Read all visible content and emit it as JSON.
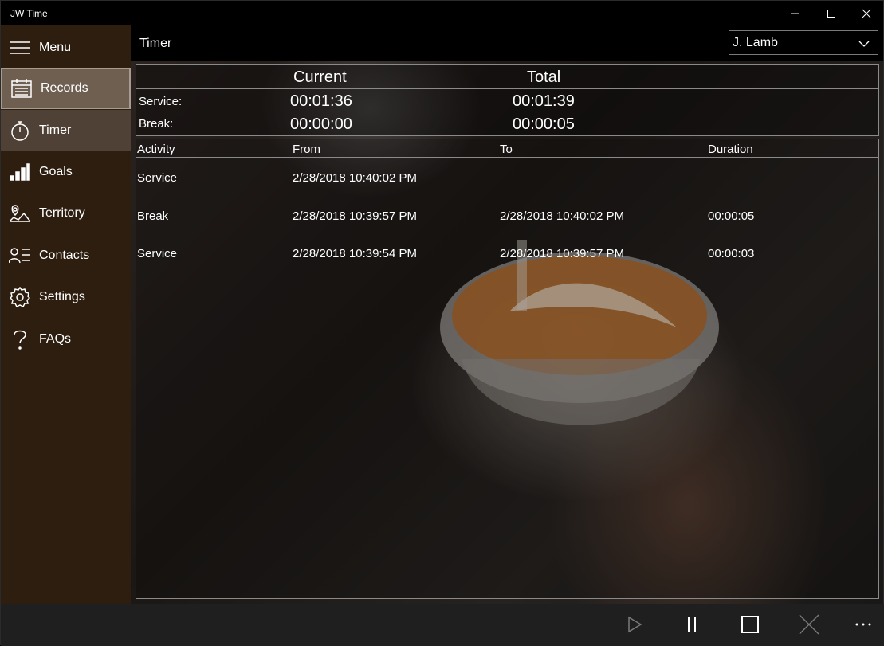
{
  "window": {
    "title": "JW Time"
  },
  "sidebar": {
    "items": [
      {
        "label": "Menu",
        "icon": "hamburger-icon"
      },
      {
        "label": "Records",
        "icon": "calendar-icon"
      },
      {
        "label": "Timer",
        "icon": "stopwatch-icon"
      },
      {
        "label": "Goals",
        "icon": "bar-chart-icon"
      },
      {
        "label": "Territory",
        "icon": "map-pin-icon"
      },
      {
        "label": "Contacts",
        "icon": "contacts-icon"
      },
      {
        "label": "Settings",
        "icon": "gear-icon"
      },
      {
        "label": "FAQs",
        "icon": "question-icon"
      }
    ],
    "selected": "Records"
  },
  "header": {
    "title": "Timer",
    "user": "J. Lamb"
  },
  "summary": {
    "columns": [
      "Current",
      "Total"
    ],
    "rows": [
      {
        "label": "Service:",
        "current": "00:01:36",
        "total": "00:01:39"
      },
      {
        "label": "Break:",
        "current": "00:00:00",
        "total": "00:00:05"
      }
    ]
  },
  "activity": {
    "columns": [
      "Activity",
      "From",
      "To",
      "Duration"
    ],
    "rows": [
      {
        "activity": "Service",
        "from": "2/28/2018 10:40:02 PM",
        "to": "",
        "duration": ""
      },
      {
        "activity": "Break",
        "from": "2/28/2018 10:39:57 PM",
        "to": "2/28/2018 10:40:02 PM",
        "duration": "00:00:05"
      },
      {
        "activity": "Service",
        "from": "2/28/2018 10:39:54 PM",
        "to": "2/28/2018 10:39:57 PM",
        "duration": "00:00:03"
      }
    ]
  },
  "appbar": {
    "buttons": [
      "play-icon",
      "pause-icon",
      "stop-icon",
      "close-icon",
      "more-icon"
    ]
  },
  "colors": {
    "sidebar": "#2e1e10",
    "selected": "#6e5f51",
    "appbar": "#1f1f1f"
  }
}
